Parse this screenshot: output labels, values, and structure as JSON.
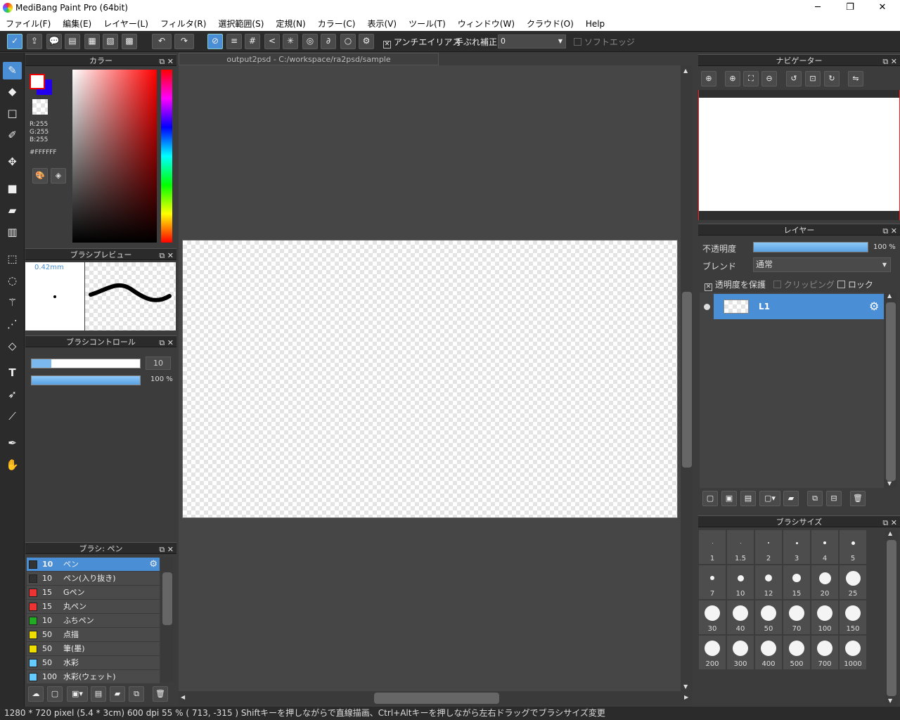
{
  "window": {
    "title": "MediBang Paint Pro (64bit)",
    "min": "─",
    "max": "❐",
    "close": "✕"
  },
  "menu": [
    "ファイル(F)",
    "編集(E)",
    "レイヤー(L)",
    "フィルタ(R)",
    "選択範囲(S)",
    "定規(N)",
    "カラー(C)",
    "表示(V)",
    "ツール(T)",
    "ウィンドウ(W)",
    "クラウド(O)",
    "Help"
  ],
  "toolbar": {
    "antialias_label": "アンチエイリアス",
    "stabilizer_label": "手ぶれ補正",
    "stabilizer_value": "0",
    "softedge_label": "ソフトエッジ"
  },
  "color_panel": {
    "title": "カラー",
    "r": "R:255",
    "g": "G:255",
    "b": "B:255",
    "hex": "#FFFFFF",
    "fg": "#ffffff",
    "bg": "#2200ee"
  },
  "brush_preview": {
    "title": "ブラシプレビュー",
    "size": "0.42mm"
  },
  "brush_control": {
    "title": "ブラシコントロール",
    "size_value": "10",
    "opacity_value": "100 %",
    "size_fraction": 0.1,
    "opacity_fraction": 1.0
  },
  "brush_list": {
    "title": "ブラシ: ペン",
    "items": [
      {
        "size": "10",
        "name": "ペン",
        "color": "#333333"
      },
      {
        "size": "10",
        "name": "ペン(入り抜き)",
        "color": "#333333"
      },
      {
        "size": "15",
        "name": "Gペン",
        "color": "#ee3333"
      },
      {
        "size": "15",
        "name": "丸ペン",
        "color": "#ee3333"
      },
      {
        "size": "10",
        "name": "ふちペン",
        "color": "#22aa22"
      },
      {
        "size": "50",
        "name": "点描",
        "color": "#eedd00"
      },
      {
        "size": "50",
        "name": "筆(墨)",
        "color": "#eedd00"
      },
      {
        "size": "50",
        "name": "水彩",
        "color": "#66ccff"
      },
      {
        "size": "100",
        "name": "水彩(ウェット)",
        "color": "#66ccff"
      }
    ]
  },
  "document": {
    "tab": "output2psd - C:/workspace/ra2psd/sample"
  },
  "navigator": {
    "title": "ナビゲーター"
  },
  "layer_panel": {
    "title": "レイヤー",
    "opacity_label": "不透明度",
    "opacity_value": "100 %",
    "opacity_fraction": 1.0,
    "blend_label": "ブレンド",
    "blend_value": "通常",
    "protect_label": "透明度を保護",
    "clipping_label": "クリッピング",
    "lock_label": "ロック",
    "layers": [
      {
        "name": "L1"
      }
    ]
  },
  "brush_size": {
    "title": "ブラシサイズ",
    "sizes": [
      "1",
      "1.5",
      "2",
      "3",
      "4",
      "5",
      "7",
      "10",
      "12",
      "15",
      "20",
      "25",
      "30",
      "40",
      "50",
      "70",
      "100",
      "150",
      "200",
      "300",
      "400",
      "500",
      "700",
      "1000"
    ]
  },
  "status": "1280 * 720 pixel   (5.4 * 3cm)   600 dpi   55 %   ( 713, -315 )   Shiftキーを押しながらで直線描画、Ctrl+Altキーを押しながら左右ドラッグでブラシサイズ変更"
}
